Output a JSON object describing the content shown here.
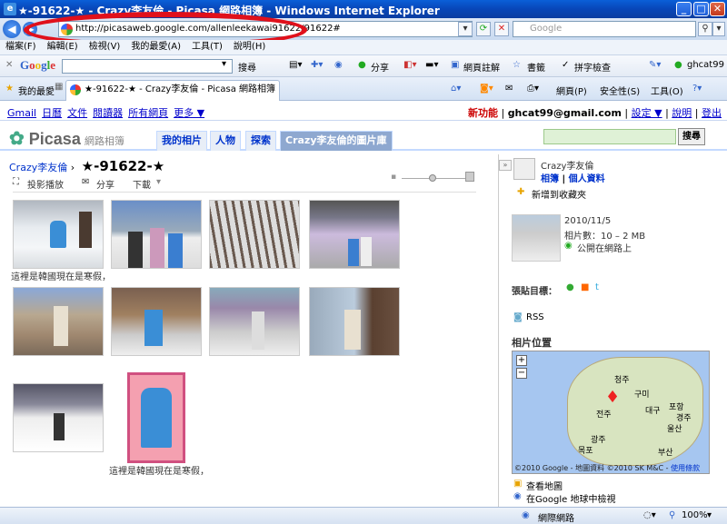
{
  "window": {
    "title": "★-91622-★ - Crazy李友倫 - Picasa 網路相簿 - Windows Internet Explorer",
    "min": "_",
    "max": "□",
    "close": "✕"
  },
  "address": {
    "url": "http://picasaweb.google.com/allenleekawai91622/91622#",
    "search_placeholder": "Google"
  },
  "menu": [
    "檔案(F)",
    "編輯(E)",
    "檢視(V)",
    "我的最愛(A)",
    "工具(T)",
    "說明(H)"
  ],
  "gtoolbar": {
    "logo": "Google",
    "items": [
      "搜尋",
      "分享",
      "網頁註解",
      "書籤",
      "拼字檢查",
      "ghcat99"
    ]
  },
  "favbar": {
    "favorites": "我的最愛",
    "tab": "★-91622-★ - Crazy李友倫 - Picasa 網路相簿",
    "page": "網頁(P)",
    "safety": "安全性(S)",
    "tools": "工具(O)"
  },
  "gbar": {
    "links": [
      "Gmail",
      "日曆",
      "文件",
      "閱讀器",
      "所有網頁",
      "更多 ▼"
    ],
    "new": "新功能",
    "email": "ghcat99@gmail.com",
    "settings": "設定 ▼",
    "help": "說明",
    "signout": "登出"
  },
  "picasa": {
    "logo": "Picasa",
    "sub": "網路相簿",
    "tabs": [
      "我的相片",
      "人物",
      "探索",
      "Crazy李友倫的圖片庫"
    ],
    "search_btn": "搜尋"
  },
  "album": {
    "owner": "Crazy李友倫",
    "title": "★-91622-★",
    "slideshow": "投影播放",
    "share": "分享",
    "download": "下載"
  },
  "photos": {
    "caption1": "這裡是韓國現在是寒假，",
    "caption2": "這裡是韓國現在是寒假，"
  },
  "sidebar": {
    "owner": "Crazy李友倫",
    "album_link": "相簿",
    "profile_link": "個人資料",
    "add_fav": "新增到收藏夾",
    "date": "2010/11/5",
    "count": "相片數：10 – 2 MB",
    "public": "公開在網路上",
    "sticker": "張貼目標：",
    "rss": "RSS",
    "location_title": "相片位置",
    "map_credit": "©2010 Google - 地圖資料 ©2010 SK M&C -",
    "terms": "使用條款",
    "view_map": "查看地圖",
    "earth": "在Google 地球中檢視",
    "cities": [
      "대구",
      "포항",
      "울산",
      "부산",
      "광주",
      "전주",
      "목포",
      "경주",
      "청주",
      "구미"
    ]
  },
  "status": {
    "zone": "網際網路",
    "zoom": "100%"
  }
}
